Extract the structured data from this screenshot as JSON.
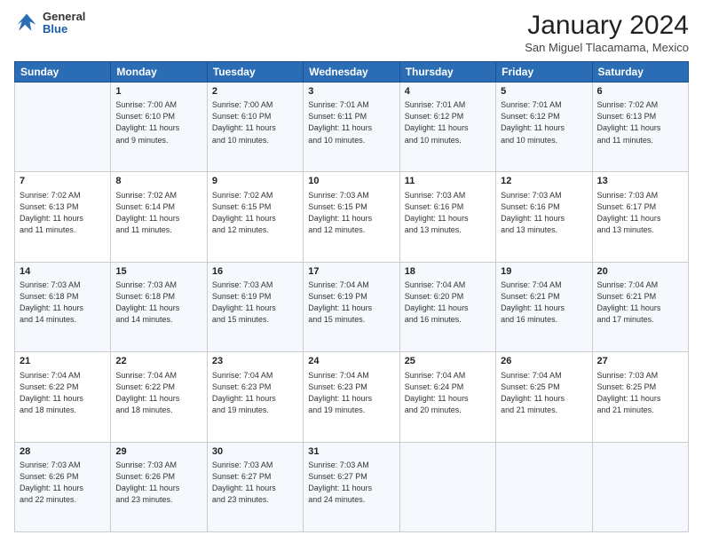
{
  "header": {
    "logo_general": "General",
    "logo_blue": "Blue",
    "month_title": "January 2024",
    "location": "San Miguel Tlacamama, Mexico"
  },
  "days_of_week": [
    "Sunday",
    "Monday",
    "Tuesday",
    "Wednesday",
    "Thursday",
    "Friday",
    "Saturday"
  ],
  "weeks": [
    [
      {
        "num": "",
        "info": ""
      },
      {
        "num": "1",
        "info": "Sunrise: 7:00 AM\nSunset: 6:10 PM\nDaylight: 11 hours\nand 9 minutes."
      },
      {
        "num": "2",
        "info": "Sunrise: 7:00 AM\nSunset: 6:10 PM\nDaylight: 11 hours\nand 10 minutes."
      },
      {
        "num": "3",
        "info": "Sunrise: 7:01 AM\nSunset: 6:11 PM\nDaylight: 11 hours\nand 10 minutes."
      },
      {
        "num": "4",
        "info": "Sunrise: 7:01 AM\nSunset: 6:12 PM\nDaylight: 11 hours\nand 10 minutes."
      },
      {
        "num": "5",
        "info": "Sunrise: 7:01 AM\nSunset: 6:12 PM\nDaylight: 11 hours\nand 10 minutes."
      },
      {
        "num": "6",
        "info": "Sunrise: 7:02 AM\nSunset: 6:13 PM\nDaylight: 11 hours\nand 11 minutes."
      }
    ],
    [
      {
        "num": "7",
        "info": "Sunrise: 7:02 AM\nSunset: 6:13 PM\nDaylight: 11 hours\nand 11 minutes."
      },
      {
        "num": "8",
        "info": "Sunrise: 7:02 AM\nSunset: 6:14 PM\nDaylight: 11 hours\nand 11 minutes."
      },
      {
        "num": "9",
        "info": "Sunrise: 7:02 AM\nSunset: 6:15 PM\nDaylight: 11 hours\nand 12 minutes."
      },
      {
        "num": "10",
        "info": "Sunrise: 7:03 AM\nSunset: 6:15 PM\nDaylight: 11 hours\nand 12 minutes."
      },
      {
        "num": "11",
        "info": "Sunrise: 7:03 AM\nSunset: 6:16 PM\nDaylight: 11 hours\nand 13 minutes."
      },
      {
        "num": "12",
        "info": "Sunrise: 7:03 AM\nSunset: 6:16 PM\nDaylight: 11 hours\nand 13 minutes."
      },
      {
        "num": "13",
        "info": "Sunrise: 7:03 AM\nSunset: 6:17 PM\nDaylight: 11 hours\nand 13 minutes."
      }
    ],
    [
      {
        "num": "14",
        "info": "Sunrise: 7:03 AM\nSunset: 6:18 PM\nDaylight: 11 hours\nand 14 minutes."
      },
      {
        "num": "15",
        "info": "Sunrise: 7:03 AM\nSunset: 6:18 PM\nDaylight: 11 hours\nand 14 minutes."
      },
      {
        "num": "16",
        "info": "Sunrise: 7:03 AM\nSunset: 6:19 PM\nDaylight: 11 hours\nand 15 minutes."
      },
      {
        "num": "17",
        "info": "Sunrise: 7:04 AM\nSunset: 6:19 PM\nDaylight: 11 hours\nand 15 minutes."
      },
      {
        "num": "18",
        "info": "Sunrise: 7:04 AM\nSunset: 6:20 PM\nDaylight: 11 hours\nand 16 minutes."
      },
      {
        "num": "19",
        "info": "Sunrise: 7:04 AM\nSunset: 6:21 PM\nDaylight: 11 hours\nand 16 minutes."
      },
      {
        "num": "20",
        "info": "Sunrise: 7:04 AM\nSunset: 6:21 PM\nDaylight: 11 hours\nand 17 minutes."
      }
    ],
    [
      {
        "num": "21",
        "info": "Sunrise: 7:04 AM\nSunset: 6:22 PM\nDaylight: 11 hours\nand 18 minutes."
      },
      {
        "num": "22",
        "info": "Sunrise: 7:04 AM\nSunset: 6:22 PM\nDaylight: 11 hours\nand 18 minutes."
      },
      {
        "num": "23",
        "info": "Sunrise: 7:04 AM\nSunset: 6:23 PM\nDaylight: 11 hours\nand 19 minutes."
      },
      {
        "num": "24",
        "info": "Sunrise: 7:04 AM\nSunset: 6:23 PM\nDaylight: 11 hours\nand 19 minutes."
      },
      {
        "num": "25",
        "info": "Sunrise: 7:04 AM\nSunset: 6:24 PM\nDaylight: 11 hours\nand 20 minutes."
      },
      {
        "num": "26",
        "info": "Sunrise: 7:04 AM\nSunset: 6:25 PM\nDaylight: 11 hours\nand 21 minutes."
      },
      {
        "num": "27",
        "info": "Sunrise: 7:03 AM\nSunset: 6:25 PM\nDaylight: 11 hours\nand 21 minutes."
      }
    ],
    [
      {
        "num": "28",
        "info": "Sunrise: 7:03 AM\nSunset: 6:26 PM\nDaylight: 11 hours\nand 22 minutes."
      },
      {
        "num": "29",
        "info": "Sunrise: 7:03 AM\nSunset: 6:26 PM\nDaylight: 11 hours\nand 23 minutes."
      },
      {
        "num": "30",
        "info": "Sunrise: 7:03 AM\nSunset: 6:27 PM\nDaylight: 11 hours\nand 23 minutes."
      },
      {
        "num": "31",
        "info": "Sunrise: 7:03 AM\nSunset: 6:27 PM\nDaylight: 11 hours\nand 24 minutes."
      },
      {
        "num": "",
        "info": ""
      },
      {
        "num": "",
        "info": ""
      },
      {
        "num": "",
        "info": ""
      }
    ]
  ]
}
